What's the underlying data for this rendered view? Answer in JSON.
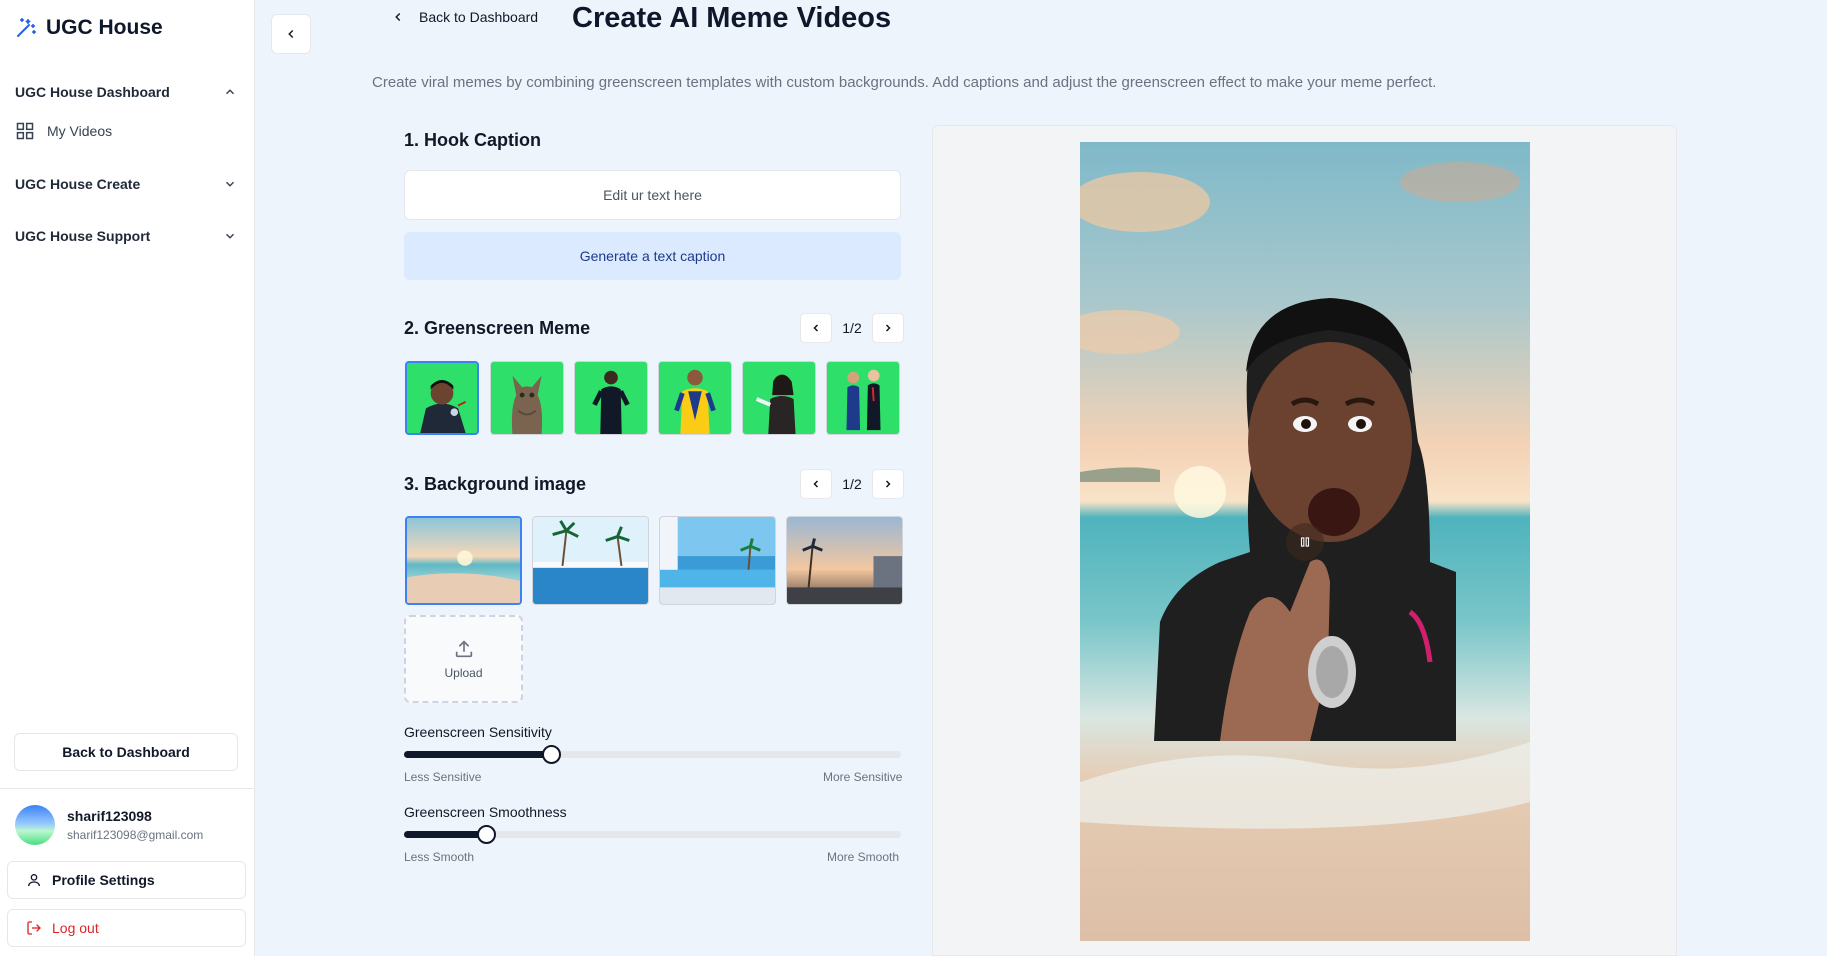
{
  "sidebar": {
    "brand": "UGC House",
    "sections": [
      {
        "label": "UGC House Dashboard",
        "expanded": true
      },
      {
        "label": "UGC House Create",
        "expanded": false
      },
      {
        "label": "UGC House Support",
        "expanded": false
      }
    ],
    "items": [
      {
        "label": "My Videos",
        "icon": "grid-icon"
      }
    ],
    "back_button": "Back to Dashboard",
    "user": {
      "name": "sharif123098",
      "email": "sharif123098@gmail.com"
    },
    "profile_settings": "Profile Settings",
    "logout": "Log out"
  },
  "header": {
    "back_link": "Back to Dashboard",
    "title": "Create AI Meme Videos",
    "description": "Create viral memes by combining greenscreen templates with custom backgrounds. Add captions and adjust the greenscreen effect to make your meme perfect."
  },
  "hook_caption": {
    "title": "1. Hook Caption",
    "placeholder": "Edit ur text here",
    "generate_button": "Generate a text caption"
  },
  "greenscreen_meme": {
    "title": "2. Greenscreen Meme",
    "page": "1/2",
    "selected_index": 0,
    "thumbnails": [
      "meme-man-microphone",
      "meme-cat",
      "meme-man-black-suit",
      "meme-yellow-costume",
      "meme-woman-pointing",
      "meme-two-men-suits"
    ]
  },
  "background_image": {
    "title": "3. Background image",
    "page": "1/2",
    "selected_index": 0,
    "thumbnails": [
      "beach-sunset",
      "pool-palms",
      "infinity-pool",
      "palm-street-sunset"
    ],
    "upload_label": "Upload"
  },
  "sliders": {
    "sensitivity": {
      "label": "Greenscreen Sensitivity",
      "value": 0.295,
      "min_label": "Less Sensitive",
      "max_label": "More Sensitive"
    },
    "smoothness": {
      "label": "Greenscreen Smoothness",
      "value": 0.165,
      "min_label": "Less Smooth",
      "max_label": "More Smooth"
    }
  },
  "preview": {
    "state": "playing",
    "control_icon": "pause-icon"
  },
  "colors": {
    "accent": "#3b82f6",
    "slider": "#0f172a",
    "greenscreen": "#2ee06a",
    "logout": "#dc2626",
    "generate_bg": "#dbeafe"
  }
}
